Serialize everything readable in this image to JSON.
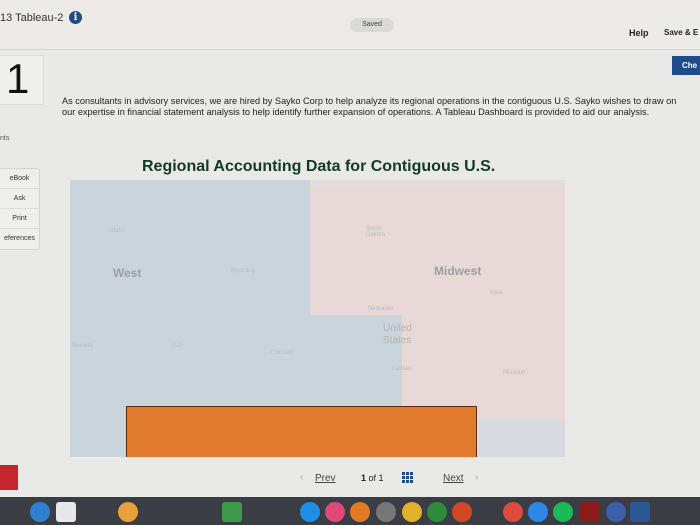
{
  "header": {
    "title": "13 Tableau-2",
    "info_icon": "info-icon",
    "saved": "Saved",
    "help": "Help",
    "save_exit": "Save & E"
  },
  "question": {
    "number": "1",
    "check_label": "Che",
    "prompt": "As consultants in advisory services, we are hired by Sayko Corp to help analyze its regional operations in the contiguous U.S. Sayko wishes to draw on our expertise in financial statement analysis to help identify further expansion of operations. A Tableau Dashboard is provided to aid our analysis.",
    "points": "nts"
  },
  "sidebar": {
    "items": [
      {
        "label": "eBook"
      },
      {
        "label": "Ask"
      },
      {
        "label": "Print"
      },
      {
        "label": "eferences"
      }
    ]
  },
  "dashboard": {
    "title": "Regional Accounting Data for Contiguous U.S.",
    "regions": [
      {
        "label": "West",
        "color": "#c9d5da"
      },
      {
        "label": "Midwest",
        "color": "#e8d8d8"
      },
      {
        "label": "",
        "color": "#e07a2c"
      }
    ],
    "country_label_1": "United",
    "country_label_2": "States",
    "states": [
      "Idaho",
      "Wyoming",
      "South Dakota",
      "Nebraska",
      "Iowa",
      "Utah",
      "Colorado",
      "Kansas",
      "Missouri",
      "Nevada"
    ]
  },
  "pagination": {
    "prev": "Prev",
    "current": "1",
    "of": "of 1",
    "next": "Next"
  },
  "colors": {
    "accent": "#1f4b8a",
    "title": "#123a26",
    "highlight": "#e07a2c"
  }
}
